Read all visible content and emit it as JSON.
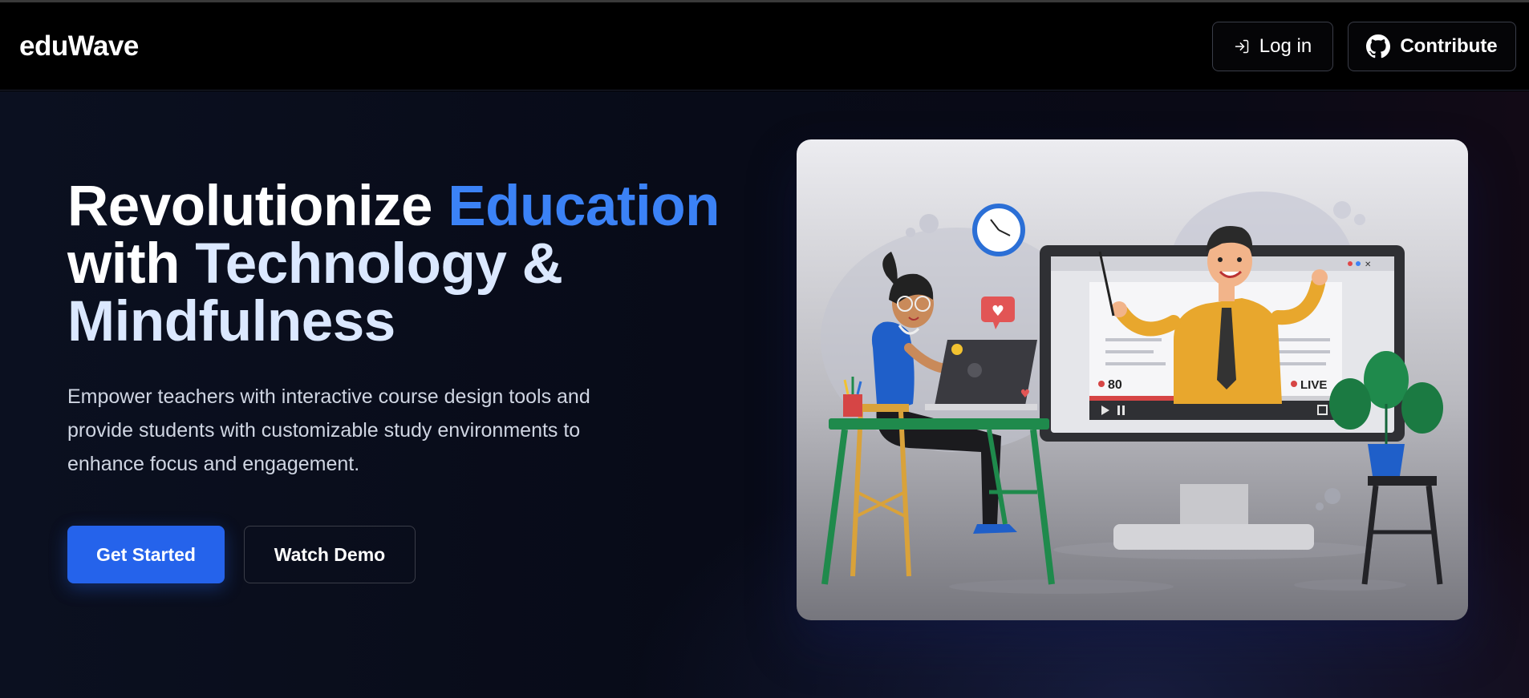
{
  "app": {
    "logo": "eduWave"
  },
  "nav": {
    "login_label": "Log in",
    "contribute_label": "Contribute",
    "login_icon": "login-icon",
    "contribute_icon": "github-icon"
  },
  "hero": {
    "headline": {
      "part1": "Revolutionize ",
      "part2": "Education",
      "part3": "with ",
      "part4": "Technology & ",
      "part5": "Mindfulness"
    },
    "subtext": "Empower teachers with interactive course design tools and provide students with customizable study environments to enhance focus and engagement.",
    "primary_cta": "Get Started",
    "secondary_cta": "Watch Demo"
  },
  "illustration": {
    "viewer_count": "80",
    "live_label": "LIVE"
  },
  "colors": {
    "accent": "#2563eb",
    "headline_highlight": "#3b82f6",
    "background": "#080b18"
  }
}
